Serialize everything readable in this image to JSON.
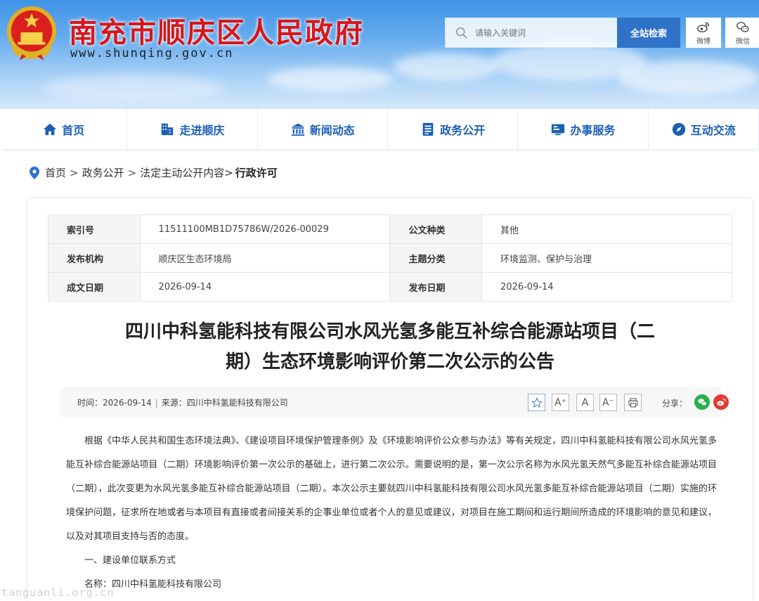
{
  "header": {
    "site_title": "南充市顺庆区人民政府",
    "site_url": "www.shunqing.gov.cn",
    "search_placeholder": "请输入关键词",
    "search_button": "全站检索",
    "weibo_label": "微博",
    "wechat_label": "微信"
  },
  "nav": {
    "items": [
      {
        "label": "首页",
        "icon": "home-icon"
      },
      {
        "label": "走进顺庆",
        "icon": "building-icon"
      },
      {
        "label": "新闻动态",
        "icon": "landmark-icon"
      },
      {
        "label": "政务公开",
        "icon": "document-icon"
      },
      {
        "label": "办事服务",
        "icon": "service-icon"
      },
      {
        "label": "互动交流",
        "icon": "compass-icon"
      }
    ]
  },
  "breadcrumb": {
    "items": [
      "首页",
      "政务公开",
      "法定主动公开内容"
    ],
    "separators": [
      ">",
      ">",
      ">"
    ],
    "current": "行政许可"
  },
  "meta": {
    "index_label": "索引号",
    "index_value": "11511100MB1D75786W/2026-00029",
    "doc_type_label": "公文种类",
    "doc_type_value": "其他",
    "org_label": "发布机构",
    "org_value": "顺庆区生态环境局",
    "topic_label": "主题分类",
    "topic_value": "环境监测、保护与治理",
    "created_label": "成文日期",
    "created_value": "2026-09-14",
    "published_label": "发布日期",
    "published_value": "2026-09-14"
  },
  "article": {
    "title_line1": "四川中科氢能科技有限公司水风光氢多能互补综合能源站项目（二",
    "title_line2": "期）生态环境影响评价第二次公示的公告",
    "time": "时间：2026-09-14",
    "source": "来源：四川中科氢能科技有限公司",
    "divider": "|",
    "share_label": "分享：",
    "tools": [
      "☆",
      "A⁺",
      "A",
      "A⁻",
      "⎙"
    ],
    "paragraph1": "根据《中华人民共和国生态环境法典》、《建设项目环境保护管理条例》及《环境影响评价公众参与办法》等有关规定，四川中科氢能科技有限公司水风光氢多能互补综合能源站项目（二期）环境影响评价第一次公示的基础上，进行第二次公示。需要说明的是，第一次公示名称为水风光氢天然气多能互补综合能源站项目（二期），此次变更为水风光氢多能互补综合能源站项目（二期）。本次公示主要就四川中科氢能科技有限公司水风光氢多能互补综合能源站项目（二期）实施的环境保护问题，征求所在地或者与本项目有直接或者间接关系的企事业单位或者个人的意见或建议，对项目在施工期间和运行期间所造成的环境影响的意见和建议，以及对其项目支持与否的态度。",
    "section1": "一、建设单位联系方式",
    "name_line": "名称：四川中科氢能科技有限公司"
  },
  "watermark": "tanguanli.org.cn",
  "colors": {
    "title_red": "#d7161b",
    "nav_blue": "#1b5fb5",
    "search_blue": "#2f73c9"
  }
}
